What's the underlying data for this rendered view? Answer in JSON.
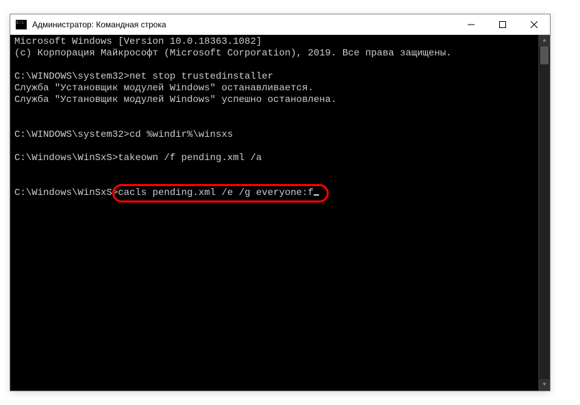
{
  "window": {
    "title": "Администратор: Командная строка"
  },
  "console": {
    "line1": "Microsoft Windows [Version 10.0.18363.1082]",
    "line2": "(c) Корпорация Майкрософт (Microsoft Corporation), 2019. Все права защищены.",
    "prompt1": "C:\\WINDOWS\\system32>",
    "cmd1": "net stop trustedinstaller",
    "out1a": "Служба \"Установщик модулей Windows\" останавливается.",
    "out1b": "Служба \"Установщик модулей Windows\" успешно остановлена.",
    "prompt2": "C:\\WINDOWS\\system32>",
    "cmd2": "cd %windir%\\winsxs",
    "prompt3": "C:\\Windows\\WinSxS>",
    "cmd3": "takeown /f pending.xml /a",
    "prompt4": "C:\\Windows\\WinSxS>",
    "cmd4": "cacls pending.xml /e /g everyone:f"
  }
}
